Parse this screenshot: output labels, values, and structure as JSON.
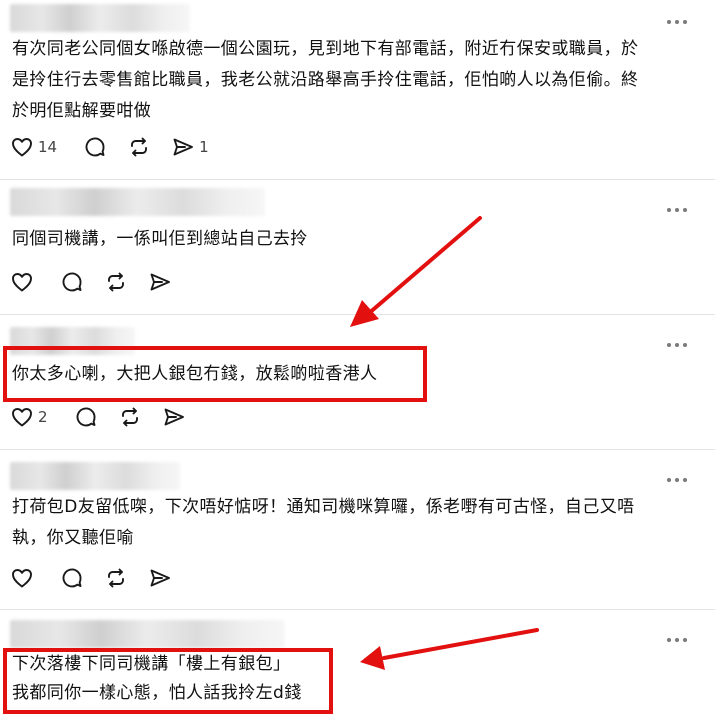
{
  "posts": [
    {
      "text_lines": [
        "有次同老公同個女喺啟德一個公園玩，見到地下有部電話，附近冇保安或職員，於",
        "是拎住行去零售館比職員，我老公就沿路舉高手拎住電話，佢怕啲人以為佢偷。終",
        "於明佢點解要咁做"
      ],
      "likes": "14",
      "shares": "1"
    },
    {
      "text_lines": [
        "同個司機講，一係叫佢到總站自己去拎"
      ],
      "likes": "",
      "shares": ""
    },
    {
      "text_lines": [
        "你太多心喇，大把人銀包冇錢，放鬆啲啦香港人"
      ],
      "likes": "2",
      "shares": ""
    },
    {
      "text_lines": [
        "打荷包D友留低㗎，下次唔好惦呀！通知司機咪算囉，係老嘢有可古怪，自己又唔",
        "執，你又聽佢喻"
      ],
      "likes": "",
      "shares": ""
    },
    {
      "text_lines": [
        "下次落樓下同司機講「樓上有銀包」",
        "我都同你一樣心態，怕人話我拎左d錢"
      ],
      "likes": "",
      "shares": ""
    }
  ],
  "icons": {
    "like": "heart-icon",
    "comment": "comment-icon",
    "repost": "repost-icon",
    "share": "share-icon",
    "more": "more-icon"
  },
  "colors": {
    "highlight": "#e31010",
    "divider": "#e3e3e3",
    "icon": "#1a1a1a"
  }
}
